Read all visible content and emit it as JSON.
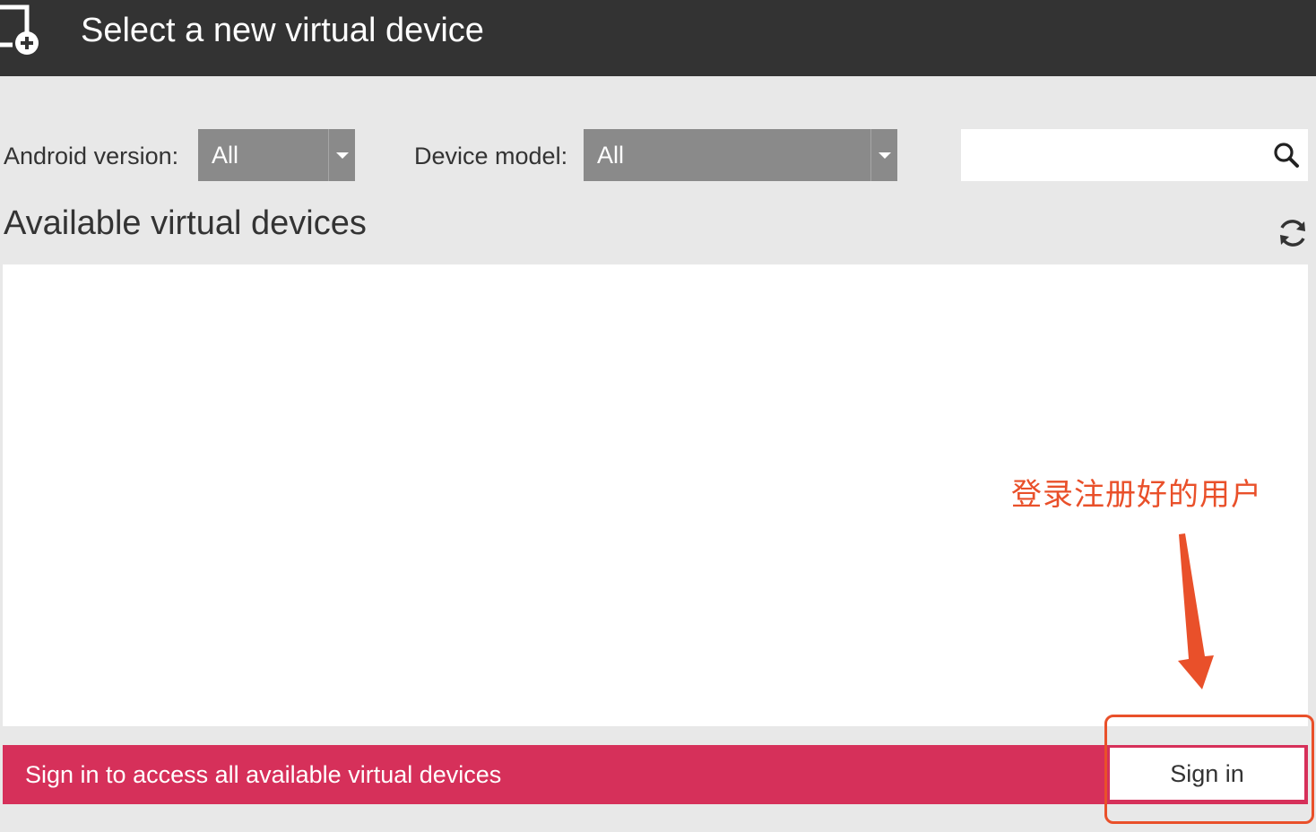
{
  "titlebar": {
    "title": "Select a new virtual device",
    "icon": "new-device-icon"
  },
  "filters": {
    "android_version_label": "Android version:",
    "android_version_value": "All",
    "device_model_label": "Device model:",
    "device_model_value": "All",
    "search_value": "",
    "search_icon": "search-icon"
  },
  "section": {
    "title": "Available virtual devices",
    "refresh_icon": "refresh-icon"
  },
  "device_list": [],
  "banner": {
    "message": "Sign in to access all available virtual devices",
    "button_label": "Sign in",
    "color": "#d6305a"
  },
  "annotation": {
    "text": "登录注册好的用户",
    "color": "#e9502a"
  }
}
